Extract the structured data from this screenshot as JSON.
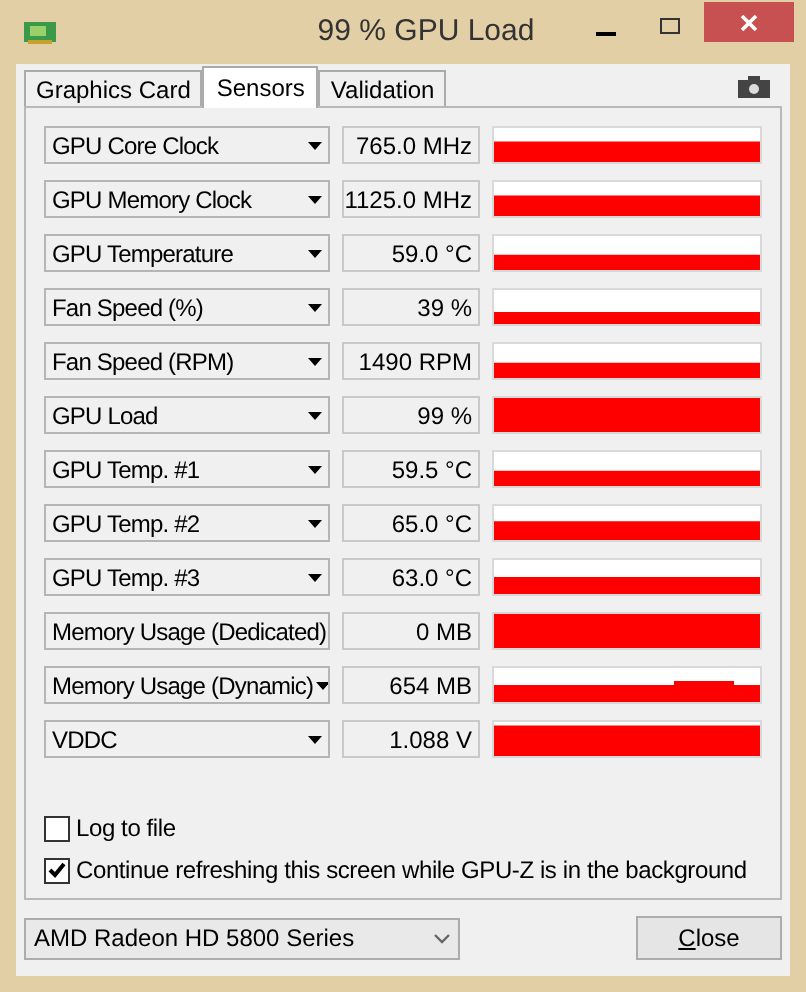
{
  "window": {
    "title": "99 % GPU Load"
  },
  "tabs": [
    {
      "label": "Graphics Card",
      "selected": false
    },
    {
      "label": "Sensors",
      "selected": true
    },
    {
      "label": "Validation",
      "selected": false
    }
  ],
  "sensors": [
    {
      "name": "GPU Core Clock",
      "reading": "765.0 MHz"
    },
    {
      "name": "GPU Memory Clock",
      "reading": "1125.0 MHz"
    },
    {
      "name": "GPU Temperature",
      "reading": "59.0 °C"
    },
    {
      "name": "Fan Speed (%)",
      "reading": "39 %"
    },
    {
      "name": "Fan Speed (RPM)",
      "reading": "1490 RPM"
    },
    {
      "name": "GPU Load",
      "reading": "99 %"
    },
    {
      "name": "GPU Temp. #1",
      "reading": "59.5 °C"
    },
    {
      "name": "GPU Temp. #2",
      "reading": "65.0 °C"
    },
    {
      "name": "GPU Temp. #3",
      "reading": "63.0 °C"
    },
    {
      "name": "Memory Usage (Dedicated)",
      "reading": "0 MB"
    },
    {
      "name": "Memory Usage (Dynamic)",
      "reading": "654 MB"
    },
    {
      "name": "VDDC",
      "reading": "1.088 V"
    }
  ],
  "options": [
    {
      "label": "Log to file",
      "checked": false
    },
    {
      "label": "Continue refreshing this screen while GPU-Z is in the background",
      "checked": true
    }
  ],
  "device_select": {
    "value": "AMD Radeon HD 5800 Series"
  },
  "close_button": {
    "label": "Close"
  }
}
